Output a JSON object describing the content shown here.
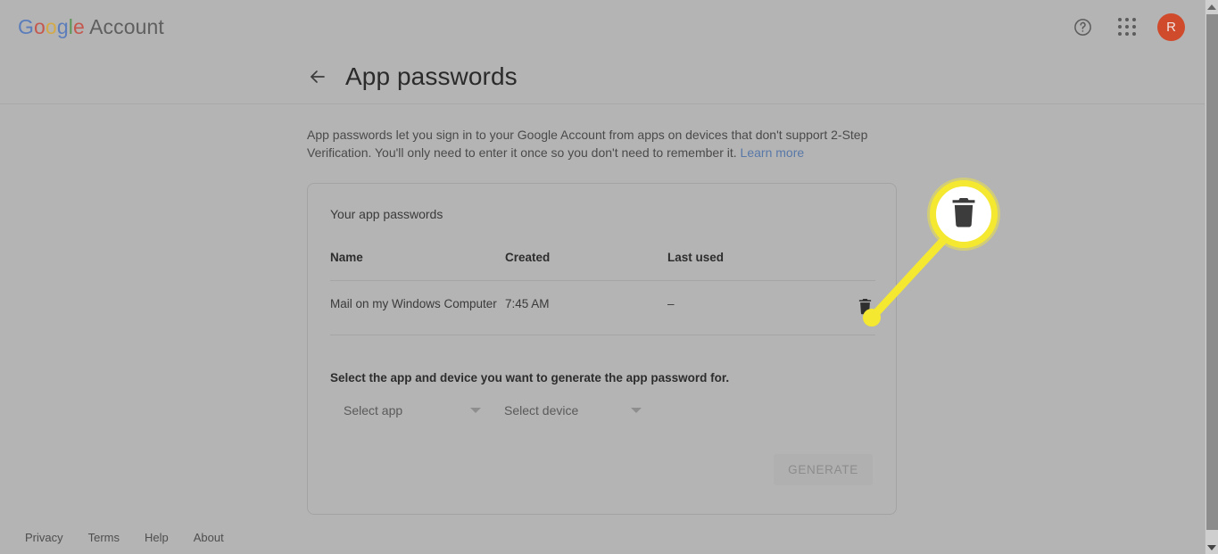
{
  "header": {
    "brand_prefix": "Google",
    "brand_word": " Account",
    "help_icon": "help-circle-icon",
    "apps_icon": "apps-grid-icon",
    "avatar_initial": "R"
  },
  "title_bar": {
    "back_icon": "back-arrow-icon",
    "title": "App passwords"
  },
  "description": {
    "text": "App passwords let you sign in to your Google Account from apps on devices that don't support 2-Step Verification. You'll only need to enter it once so you don't need to remember it. ",
    "link_label": "Learn more"
  },
  "card": {
    "section_title": "Your app passwords",
    "table": {
      "columns": [
        "Name",
        "Created",
        "Last used"
      ],
      "rows": [
        {
          "name": "Mail on my Windows Computer",
          "created": "7:45 AM",
          "last_used": "–",
          "delete_icon": "trash-icon"
        }
      ]
    },
    "select_instruction": "Select the app and device you want to generate the app password for.",
    "select_app": {
      "value": "Select app",
      "caret_icon": "chevron-down-icon"
    },
    "select_device": {
      "value": "Select device",
      "caret_icon": "chevron-down-icon"
    },
    "generate_label": "GENERATE"
  },
  "footer": {
    "links": [
      "Privacy",
      "Terms",
      "Help",
      "About"
    ]
  },
  "callout": {
    "icon": "trash-icon",
    "highlight_color": "#f5e830"
  },
  "scrollbar": {
    "up_icon": "scroll-up-arrow-icon",
    "down_icon": "scroll-down-arrow-icon"
  }
}
